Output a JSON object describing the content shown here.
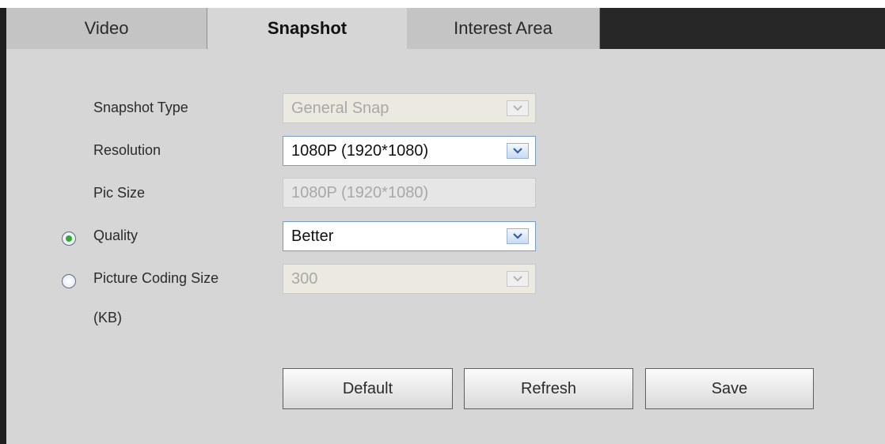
{
  "tabs": [
    {
      "label": "Video",
      "active": false
    },
    {
      "label": "Snapshot",
      "active": true
    },
    {
      "label": "Interest Area",
      "active": false
    }
  ],
  "form": {
    "snapshot_type": {
      "label": "Snapshot Type",
      "value": "General Snap",
      "enabled": false
    },
    "resolution": {
      "label": "Resolution",
      "value": "1080P (1920*1080)",
      "enabled": true
    },
    "pic_size": {
      "label": "Pic Size",
      "value": "1080P (1920*1080)",
      "enabled": false
    },
    "quality": {
      "label": "Quality",
      "value": "Better",
      "enabled": true,
      "radio_selected": true
    },
    "picture_coding_size": {
      "label_line1": "Picture Coding Size",
      "label_line2": "(KB)",
      "value": "300",
      "enabled": false,
      "radio_selected": false
    }
  },
  "buttons": {
    "default_label": "Default",
    "refresh_label": "Refresh",
    "save_label": "Save"
  },
  "colors": {
    "radio_selected": "#34a834",
    "select_arrow": "#2f5fa8"
  }
}
